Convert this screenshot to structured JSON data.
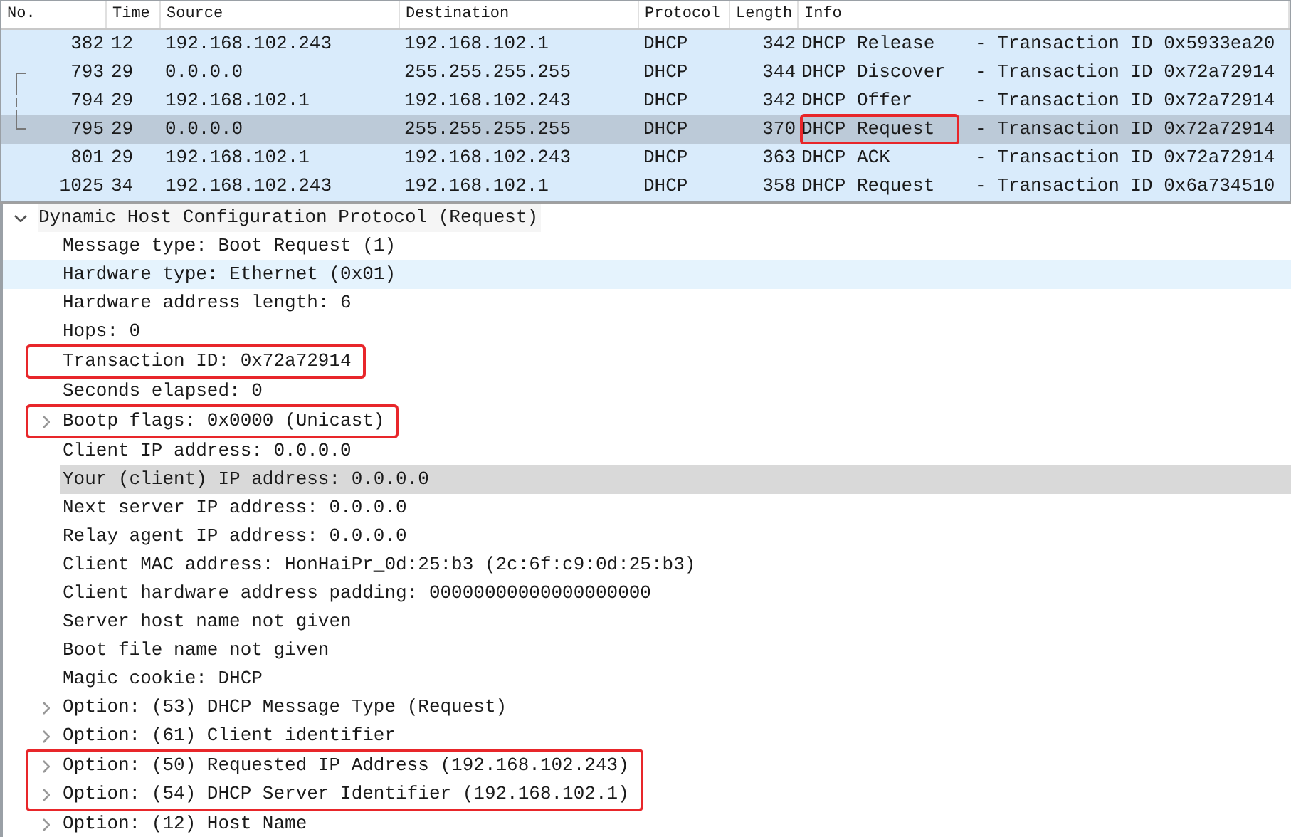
{
  "packet_list": {
    "columns": [
      {
        "label": "No."
      },
      {
        "label": "Time"
      },
      {
        "label": "Source"
      },
      {
        "label": "Destination"
      },
      {
        "label": "Protocol"
      },
      {
        "label": "Length"
      },
      {
        "label": "Info"
      }
    ],
    "rows": [
      {
        "no": "382",
        "time": "12",
        "source": "192.168.102.243",
        "destination": "192.168.102.1",
        "protocol": "DHCP",
        "length": "342",
        "message": "DHCP Release",
        "transaction": "- Transaction ID 0x5933ea20",
        "selected": false,
        "marked": false,
        "related": false
      },
      {
        "no": "793",
        "time": "29",
        "source": "0.0.0.0",
        "destination": "255.255.255.255",
        "protocol": "DHCP",
        "length": "344",
        "message": "DHCP Discover",
        "transaction": "- Transaction ID 0x72a72914",
        "selected": false,
        "marked": false,
        "related": true
      },
      {
        "no": "794",
        "time": "29",
        "source": "192.168.102.1",
        "destination": "192.168.102.243",
        "protocol": "DHCP",
        "length": "342",
        "message": "DHCP Offer",
        "transaction": "- Transaction ID 0x72a72914",
        "selected": false,
        "marked": false,
        "related": true
      },
      {
        "no": "795",
        "time": "29",
        "source": "0.0.0.0",
        "destination": "255.255.255.255",
        "protocol": "DHCP",
        "length": "370",
        "message": "DHCP Request",
        "transaction": "- Transaction ID 0x72a72914",
        "selected": true,
        "marked": true,
        "related": true
      },
      {
        "no": "801",
        "time": "29",
        "source": "192.168.102.1",
        "destination": "192.168.102.243",
        "protocol": "DHCP",
        "length": "363",
        "message": "DHCP ACK",
        "transaction": "- Transaction ID 0x72a72914",
        "selected": false,
        "marked": false,
        "related": false
      },
      {
        "no": "1025",
        "time": "34",
        "source": "192.168.102.243",
        "destination": "192.168.102.1",
        "protocol": "DHCP",
        "length": "358",
        "message": "DHCP Request",
        "transaction": "- Transaction ID 0x6a734510",
        "selected": false,
        "marked": false,
        "related": false
      }
    ]
  },
  "details": {
    "label": "Dynamic Host Configuration Protocol (Request)",
    "expanded": true,
    "children": [
      {
        "label": "Message type: Boot Request (1)",
        "expandable": false,
        "selected": false,
        "hovered": false,
        "marked": false
      },
      {
        "label": "Hardware type: Ethernet (0x01)",
        "expandable": false,
        "selected": false,
        "hovered": true,
        "marked": false
      },
      {
        "label": "Hardware address length: 6",
        "expandable": false,
        "selected": false,
        "hovered": false,
        "marked": false
      },
      {
        "label": "Hops: 0",
        "expandable": false,
        "selected": false,
        "hovered": false,
        "marked": false
      },
      {
        "label": "Transaction ID: 0x72a72914",
        "expandable": false,
        "selected": false,
        "hovered": false,
        "marked": true
      },
      {
        "label": "Seconds elapsed: 0",
        "expandable": false,
        "selected": false,
        "hovered": false,
        "marked": false
      },
      {
        "label": "Bootp flags: 0x0000 (Unicast)",
        "expandable": true,
        "selected": false,
        "hovered": false,
        "marked": true
      },
      {
        "label": "Client IP address: 0.0.0.0",
        "expandable": false,
        "selected": false,
        "hovered": false,
        "marked": false
      },
      {
        "label": "Your (client) IP address: 0.0.0.0",
        "expandable": false,
        "selected": true,
        "hovered": false,
        "marked": false
      },
      {
        "label": "Next server IP address: 0.0.0.0",
        "expandable": false,
        "selected": false,
        "hovered": false,
        "marked": false
      },
      {
        "label": "Relay agent IP address: 0.0.0.0",
        "expandable": false,
        "selected": false,
        "hovered": false,
        "marked": false
      },
      {
        "label": "Client MAC address: HonHaiPr_0d:25:b3 (2c:6f:c9:0d:25:b3)",
        "expandable": false,
        "selected": false,
        "hovered": false,
        "marked": false
      },
      {
        "label": "Client hardware address padding: 00000000000000000000",
        "expandable": false,
        "selected": false,
        "hovered": false,
        "marked": false
      },
      {
        "label": "Server host name not given",
        "expandable": false,
        "selected": false,
        "hovered": false,
        "marked": false
      },
      {
        "label": "Boot file name not given",
        "expandable": false,
        "selected": false,
        "hovered": false,
        "marked": false
      },
      {
        "label": "Magic cookie: DHCP",
        "expandable": false,
        "selected": false,
        "hovered": false,
        "marked": false
      },
      {
        "label": "Option: (53) DHCP Message Type (Request)",
        "expandable": true,
        "selected": false,
        "hovered": false,
        "marked": false
      },
      {
        "label": "Option: (61) Client identifier",
        "expandable": true,
        "selected": false,
        "hovered": false,
        "marked": false
      },
      {
        "label": "Option: (50) Requested IP Address (192.168.102.243)",
        "expandable": true,
        "selected": false,
        "hovered": false,
        "marked": true
      },
      {
        "label": "Option: (54) DHCP Server Identifier (192.168.102.1)",
        "expandable": true,
        "selected": false,
        "hovered": false,
        "marked": true
      },
      {
        "label": "Option: (12) Host Name",
        "expandable": true,
        "selected": false,
        "hovered": false,
        "marked": false
      }
    ]
  }
}
